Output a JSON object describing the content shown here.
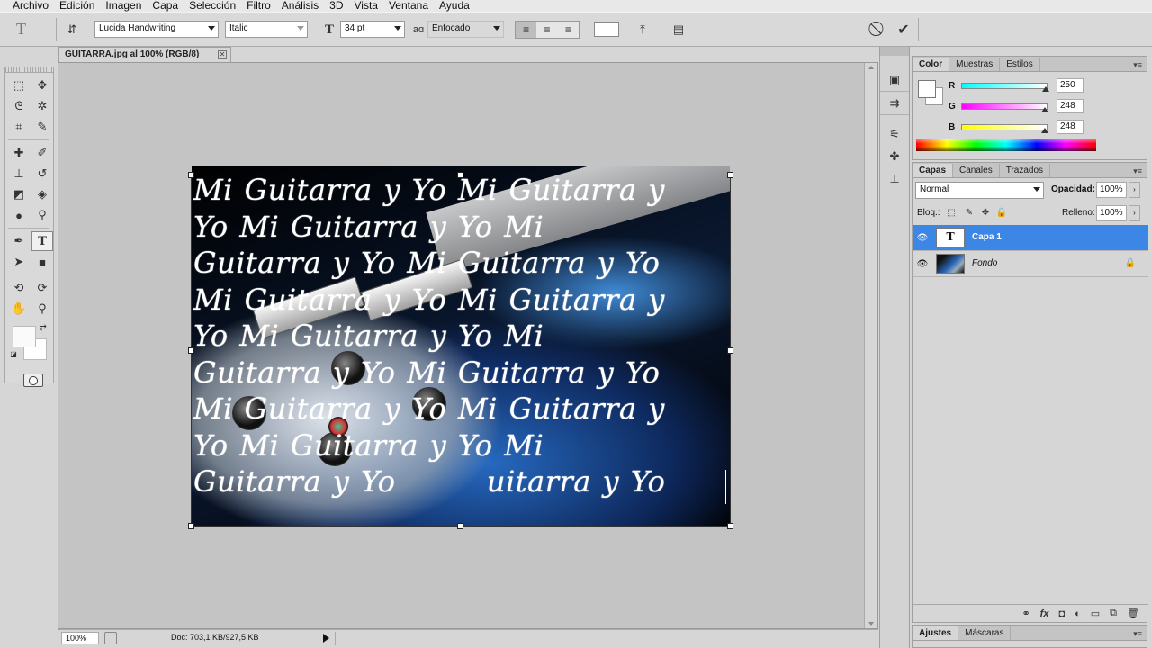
{
  "menu": [
    "Archivo",
    "Edición",
    "Imagen",
    "Capa",
    "Selección",
    "Filtro",
    "Análisis",
    "3D",
    "Vista",
    "Ventana",
    "Ayuda"
  ],
  "options_bar": {
    "tool_glyph": "T",
    "font_family": "Lucida Handwriting",
    "font_style": "Italic",
    "font_size": "34 pt",
    "antialias_glyph": "aɑ",
    "antialias": "Enfocado",
    "text_color": "#ffffff"
  },
  "document": {
    "tab_title": "GUITARRA.jpg al 100% (RGB/8)",
    "text_lines": [
      "Mi Guitarra y Yo Mi Guitarra y",
      "Yo Mi Guitarra y Yo Mi",
      "Guitarra y Yo Mi Guitarra y Yo",
      "Mi Guitarra y Yo Mi Guitarra y",
      "Yo Mi Guitarra y Yo Mi",
      "Guitarra y Yo Mi Guitarra y Yo",
      "Mi Guitarra y Yo Mi Guitarra y",
      "Yo Mi Guitarra y Yo Mi",
      "Guitarra y Yo        uitarra y Yo"
    ]
  },
  "status": {
    "zoom": "100%",
    "doc_info": "Doc: 703,1 KB/927,5 KB"
  },
  "color_panel": {
    "tabs": [
      "Color",
      "Muestras",
      "Estilos"
    ],
    "r_label": "R",
    "g_label": "G",
    "b_label": "B",
    "r": "250",
    "g": "248",
    "b": "248",
    "r_fraction": 0.98,
    "g_fraction": 0.97,
    "b_fraction": 0.97,
    "foreground": "#faf8f8"
  },
  "layers_panel": {
    "tabs": [
      "Capas",
      "Canales",
      "Trazados"
    ],
    "blend_mode": "Normal",
    "opacity_label": "Opacidad:",
    "opacity": "100%",
    "lock_label": "Bloq.:",
    "fill_label": "Relleno:",
    "fill": "100%",
    "layers": [
      {
        "name": "Capa 1",
        "thumb": "T",
        "selected": true
      },
      {
        "name": "Fondo",
        "thumb": "",
        "selected": false,
        "locked": true
      }
    ]
  },
  "adjust_panel": {
    "tabs": [
      "Ajustes",
      "Máscaras"
    ]
  },
  "colors": {
    "selection": "#3c86e6",
    "panel": "#d6d6d6"
  }
}
